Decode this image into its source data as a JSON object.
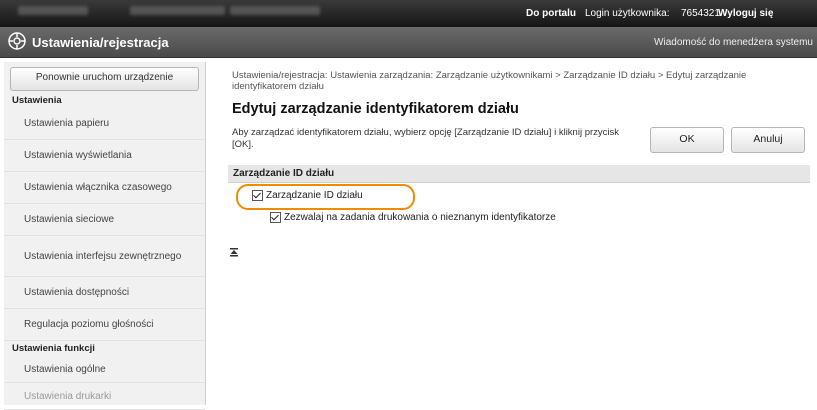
{
  "header": {
    "portal_link": "Do portalu",
    "login_label": "Login użytkownika:",
    "user_id": "7654321",
    "logout": "Wyloguj się"
  },
  "titlebar": {
    "logo_icon": "settings-logo-icon",
    "title": "Ustawienia/rejestracja",
    "message": "Wiadomość do menedżera systemu"
  },
  "sidebar": {
    "restart_button": "Ponownie uruchom urządzenie",
    "section1": "Ustawienia",
    "items": [
      "Ustawienia papieru",
      "Ustawienia wyświetlania",
      "Ustawienia włącznika czasowego",
      "Ustawienia sieciowe",
      "Ustawienia interfejsu zewnętrznego",
      "Ustawienia dostępności",
      "Regulacja poziomu głośności"
    ],
    "section2": "Ustawienia funkcji",
    "items2": [
      "Ustawienia ogólne",
      "Ustawienia drukarki"
    ]
  },
  "main": {
    "breadcrumb": "Ustawienia/rejestracja: Ustawienia zarządzania: Zarządzanie użytkownikami > Zarządzanie ID działu > Edytuj zarządzanie identyfikatorem działu",
    "title": "Edytuj zarządzanie identyfikatorem działu",
    "description": "Aby zarządzać identyfikatorem działu, wybierz opcję [Zarządzanie ID działu] i kliknij przycisk [OK].",
    "ok_button": "OK",
    "cancel_button": "Anuluj",
    "section_title": "Zarządzanie ID działu",
    "checkbox1": {
      "label": "Zarządzanie ID działu",
      "checked": true
    },
    "checkbox2": {
      "label": "Zezwalaj na zadania drukowania o nieznanym identyfikatorze",
      "checked": true
    },
    "to_top_icon": "to-top-icon"
  },
  "colors": {
    "highlight": "#f08a00",
    "header_bg": "#1f1f1f",
    "titlebar_bg": "#5a5a5a"
  }
}
